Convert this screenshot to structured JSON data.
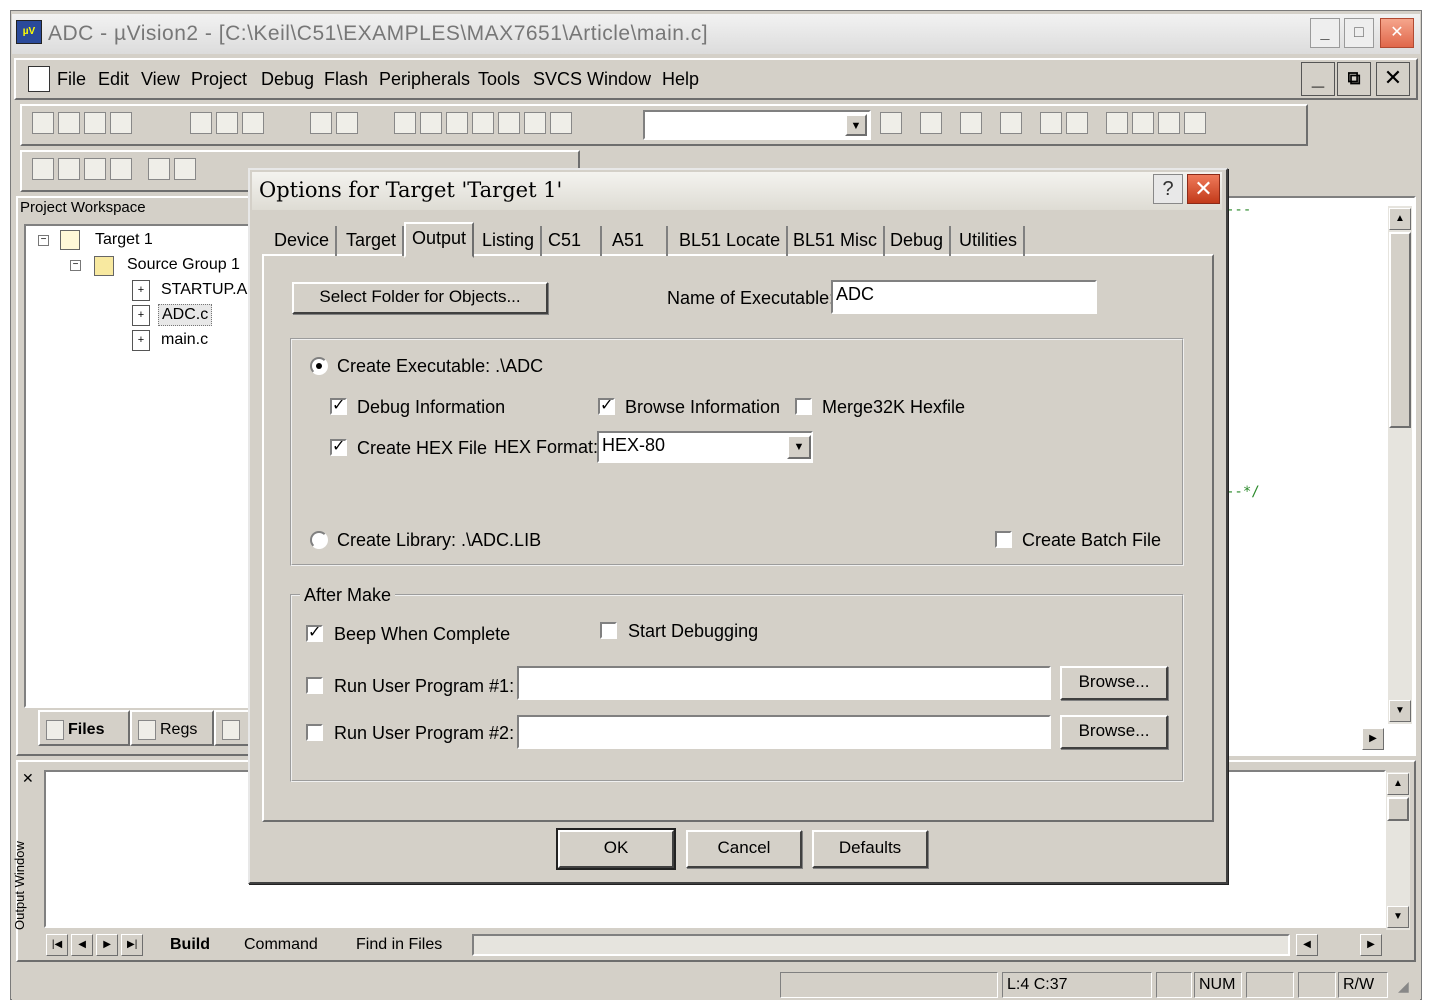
{
  "window": {
    "title": "ADC  - µVision2 - [C:\\Keil\\C51\\EXAMPLES\\MAX7651\\Article\\main.c]"
  },
  "menu": [
    "File",
    "Edit",
    "View",
    "Project",
    "Debug",
    "Flash",
    "Peripherals",
    "Tools",
    "SVCS",
    "Window",
    "Help"
  ],
  "workspace": {
    "title": "Project Workspace",
    "tree": {
      "target": "Target 1",
      "group": "Source Group 1",
      "files": [
        "STARTUP.A",
        "ADC.c",
        "main.c"
      ]
    },
    "tabs": [
      "Files",
      "Regs"
    ]
  },
  "editor": {
    "fragments": [
      "---",
      "--*/"
    ]
  },
  "output": {
    "vertical_label": "Output Window",
    "tabs": [
      "Build",
      "Command",
      "Find in Files"
    ]
  },
  "status": {
    "position": "L:4 C:37",
    "num": "NUM",
    "rw": "R/W"
  },
  "dialog": {
    "title": "Options for Target 'Target 1'",
    "tabs": [
      "Device",
      "Target",
      "Output",
      "Listing",
      "C51",
      "A51",
      "BL51 Locate",
      "BL51 Misc",
      "Debug",
      "Utilities"
    ],
    "active_tab": "Output",
    "select_folder_label": "Select Folder for Objects...",
    "name_exec_label": "Name of Executable:",
    "name_exec_value": "ADC",
    "create_exec_label": "Create Executable:  .\\ADC",
    "debug_info_label": "Debug Information",
    "browse_info_label": "Browse Information",
    "merge_label": "Merge32K Hexfile",
    "create_hex_label": "Create HEX File",
    "hex_format_label": "HEX Format:",
    "hex_format_value": "HEX-80",
    "create_lib_label": "Create Library:  .\\ADC.LIB",
    "create_batch_label": "Create Batch File",
    "after_make_label": "After Make",
    "beep_label": "Beep When Complete",
    "start_debug_label": "Start Debugging",
    "run1_label": "Run User Program #1:",
    "run2_label": "Run User Program #2:",
    "run1_value": "",
    "run2_value": "",
    "browse_label": "Browse...",
    "ok_label": "OK",
    "cancel_label": "Cancel",
    "defaults_label": "Defaults"
  },
  "colors": {
    "chrome": "#d4d0c8",
    "close_button": "#c23a1a",
    "comment_green": "#2a8a2a"
  }
}
